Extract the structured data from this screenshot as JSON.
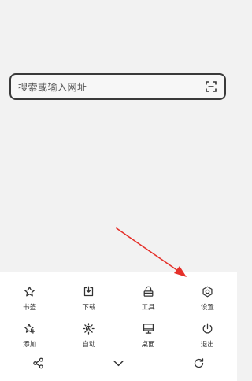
{
  "search": {
    "placeholder": "搜索或输入网址",
    "scan_icon": "scan-icon"
  },
  "menu": {
    "items": [
      {
        "label": "书签",
        "icon": "star-icon"
      },
      {
        "label": "下载",
        "icon": "download-icon"
      },
      {
        "label": "工具",
        "icon": "toolbox-icon"
      },
      {
        "label": "设置",
        "icon": "hexagon-settings-icon"
      },
      {
        "label": "添加",
        "icon": "add-star-icon"
      },
      {
        "label": "自动",
        "icon": "auto-brightness-icon"
      },
      {
        "label": "桌面",
        "icon": "desktop-icon"
      },
      {
        "label": "退出",
        "icon": "power-icon"
      }
    ]
  },
  "bottom_bar": {
    "left_icon": "share-icon",
    "center_icon": "chevron-down-icon",
    "right_icon": "refresh-icon"
  },
  "colors": {
    "page_bg": "#f2f2f2",
    "sheet_bg": "#ffffff",
    "icon": "#333333",
    "annotation": "#e5302a"
  }
}
